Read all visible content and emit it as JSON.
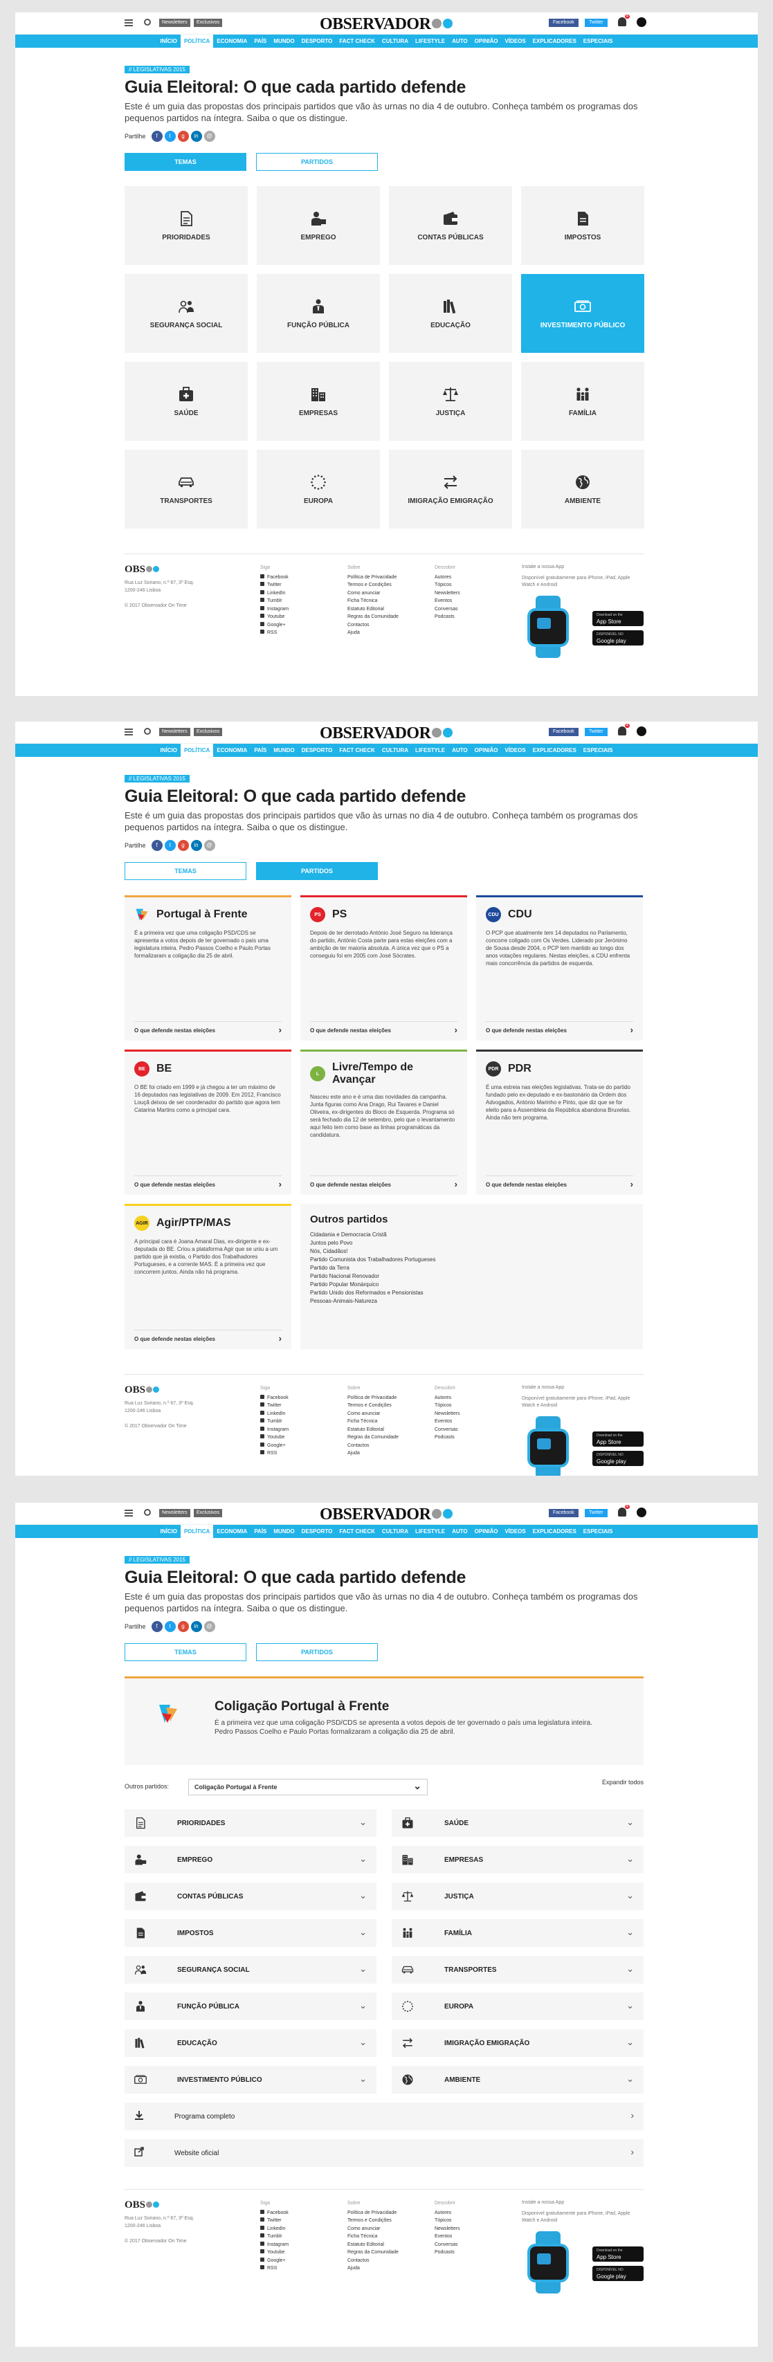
{
  "header": {
    "logo": "OBSERVADOR",
    "tag_newsletters": "Newsletters",
    "tag_exclusive": "Exclusivos",
    "facebook": "Facebook",
    "twitter": "Twitter",
    "notifications": "4"
  },
  "nav": [
    "INÍCIO",
    "POLÍTICA",
    "ECONOMIA",
    "PAÍS",
    "MUNDO",
    "DESPORTO",
    "FACT CHECK",
    "CULTURA",
    "LIFESTYLE",
    "AUTO",
    "OPINIÃO",
    "VÍDEOS",
    "EXPLICADORES",
    "ESPECIAIS"
  ],
  "nav_active": "POLÍTICA",
  "article": {
    "kicker": "// LEGISLATIVAS 2015",
    "title": "Guia Eleitoral: O que cada partido defende",
    "lead": "Este é um guia das propostas dos principais partidos que vão às urnas no dia 4 de outubro. Conheça também os programas dos pequenos partidos na íntegra. Saiba o que os distingue.",
    "share_label": "Partilhe",
    "tab_themes": "TEMAS",
    "tab_parties": "PARTIDOS"
  },
  "themes": [
    {
      "label": "PRIORIDADES",
      "icon": "document-icon"
    },
    {
      "label": "EMPREGO",
      "icon": "worker-icon"
    },
    {
      "label": "CONTAS PÚBLICAS",
      "icon": "wallet-icon"
    },
    {
      "label": "IMPOSTOS",
      "icon": "tax-document-icon"
    },
    {
      "label": "SEGURANÇA SOCIAL",
      "icon": "people-icon"
    },
    {
      "label": "FUNÇÃO PÚBLICA",
      "icon": "civil-servant-icon"
    },
    {
      "label": "EDUCAÇÃO",
      "icon": "books-icon"
    },
    {
      "label": "INVESTIMENTO PÚBLICO",
      "icon": "money-icon"
    },
    {
      "label": "SAÚDE",
      "icon": "medical-kit-icon"
    },
    {
      "label": "EMPRESAS",
      "icon": "buildings-icon"
    },
    {
      "label": "JUSTIÇA",
      "icon": "scales-icon"
    },
    {
      "label": "FAMÍLIA",
      "icon": "family-icon"
    },
    {
      "label": "TRANSPORTES",
      "icon": "car-icon"
    },
    {
      "label": "EUROPA",
      "icon": "eu-stars-icon"
    },
    {
      "label": "IMIGRAÇÃO EMIGRAÇÃO",
      "icon": "arrows-icon"
    },
    {
      "label": "AMBIENTE",
      "icon": "globe-icon"
    }
  ],
  "theme_active": "INVESTIMENTO PÚBLICO",
  "parties": [
    {
      "name": "Portugal à Frente",
      "color": "#f0a63f",
      "logo_text": "",
      "desc": "É a primeira vez que uma coligação PSD/CDS se apresenta a votos depois de ter governado o país uma legislatura inteira. Pedro Passos Coelho e Paulo Portas formalizaram a coligação dia 25 de abril.",
      "link": "O que defende nestas eleições"
    },
    {
      "name": "PS",
      "color": "#e3222b",
      "logo_text": "PS",
      "desc": "Depois de ter derrotado António José Seguro na liderança do partido, António Costa parte para estas eleições com a ambição de ter maioria absoluta. A única vez que o PS a conseguiu foi em 2005 com José Sócrates.",
      "link": "O que defende nestas eleições"
    },
    {
      "name": "CDU",
      "color": "#1e4a9a",
      "logo_text": "CDU",
      "desc": "O PCP que atualmente tem 14 deputados no Parlamento, concorre coligado com Os Verdes. Liderado por Jerónimo de Sousa desde 2004, o PCP tem mantido ao longo dos anos votações regulares. Nestas eleições, a CDU enfrenta mais concorrência da partidos de esquerda.",
      "link": "O que defende nestas eleições"
    },
    {
      "name": "BE",
      "color": "#e3222b",
      "logo_text": "BE",
      "desc": "O BE foi criado em 1999 e já chegou a ter um máximo de 16 deputados nas legislativas de 2009. Em 2012, Francisco Louçã deixou de ser coordenador do partido que agora tem Catarina Martins como a principal cara.",
      "link": "O que defende nestas eleições"
    },
    {
      "name": "Livre/Tempo de Avançar",
      "color": "#7cb342",
      "logo_text": "L",
      "desc": "Nasceu este ano e é uma das novidades da campanha. Junta figuras como Ana Drago, Rui Tavares e Daniel Oliveira, ex-dirigentes do Bloco de Esquerda. Programa só será fechado dia 12 de setembro, pelo que o levantamento aqui feito tem como base as linhas programáticas da candidatura.",
      "link": "O que defende nestas eleições"
    },
    {
      "name": "PDR",
      "color": "#333333",
      "logo_text": "PDR",
      "desc": "É uma estreia nas eleições legislativas. Trata-se do partido fundado pelo ex-deputado e ex-bastonário da Ordem dos Advogados, António Marinho e Pinto, que diz que se for eleito para a Assembleia da República abandona Bruxelas. Ainda não tem programa.",
      "link": "O que defende nestas eleições"
    },
    {
      "name": "Agir/PTP/MAS",
      "color": "#f5d01f",
      "logo_text": "AGIR",
      "desc": "A principal cara é Joana Amaral Dias, ex-dirigente e ex-deputada do BE. Criou a plataforma Agir que se uniu a um partido que já existia, o Partido dos Trabalhadores Portugueses, e a corrente MAS. É a primeira vez que concorrem juntos. Ainda não há programa.",
      "link": "O que defende nestas eleições"
    }
  ],
  "other_parties": {
    "title": "Outros partidos",
    "items": [
      "Cidadania e Democracia Cristã",
      "Juntos pelo Povo",
      "Nós, Cidadãos!",
      "Partido Comunista dos Trabalhadores Portugueses",
      "Partido da Terra",
      "Partido Nacional Renovador",
      "Partido Popular Monárquico",
      "Partido Unido dos Reformados e Pensionistas",
      "Pessoas-Animais-Natureza"
    ]
  },
  "party_detail": {
    "name": "Coligação Portugal à Frente",
    "desc": "É a primeira vez que uma coligação PSD/CDS se apresenta a votos depois de ter governado o país uma legislatura inteira. Pedro Passos Coelho e Paulo Portas formalizaram a coligação dia 25 de abril.",
    "select_label": "Outros partidos:",
    "select_value": "Coligação Portugal à Frente",
    "expand_all": "Expandir todos",
    "accordion_left": [
      {
        "label": "PRIORIDADES",
        "icon": "document-icon"
      },
      {
        "label": "EMPREGO",
        "icon": "worker-icon"
      },
      {
        "label": "CONTAS PÚBLICAS",
        "icon": "wallet-icon"
      },
      {
        "label": "IMPOSTOS",
        "icon": "tax-document-icon"
      },
      {
        "label": "SEGURANÇA SOCIAL",
        "icon": "people-icon"
      },
      {
        "label": "FUNÇÃO PÚBLICA",
        "icon": "civil-servant-icon"
      },
      {
        "label": "EDUCAÇÃO",
        "icon": "books-icon"
      },
      {
        "label": "INVESTIMENTO PÚBLICO",
        "icon": "money-icon"
      }
    ],
    "accordion_right": [
      {
        "label": "SAÚDE",
        "icon": "medical-kit-icon"
      },
      {
        "label": "EMPRESAS",
        "icon": "buildings-icon"
      },
      {
        "label": "JUSTIÇA",
        "icon": "scales-icon"
      },
      {
        "label": "FAMÍLIA",
        "icon": "family-icon"
      },
      {
        "label": "TRANSPORTES",
        "icon": "car-icon"
      },
      {
        "label": "EUROPA",
        "icon": "eu-stars-icon"
      },
      {
        "label": "IMIGRAÇÃO EMIGRAÇÃO",
        "icon": "arrows-icon"
      },
      {
        "label": "AMBIENTE",
        "icon": "globe-icon"
      }
    ],
    "full_program": "Programa completo",
    "website": "Website oficial"
  },
  "footer": {
    "logo": "OBS",
    "address": [
      "Rua Luz Soriano, n.º 67, 3º Esq.",
      "1200-246 Lisboa",
      "",
      "© 2017 Observador On Time"
    ],
    "col1_title": "Siga",
    "col1": [
      "Facebook",
      "Twitter",
      "LinkedIn",
      "Tumblr",
      "Instagram",
      "Youtube",
      "Google+",
      "RSS"
    ],
    "col2_title": "Sobre",
    "col2": [
      "Política de Privacidade",
      "Termos e Condições",
      "Como anunciar",
      "Ficha Técnica",
      "Estatuto Editorial",
      "Regras da Comunidade",
      "Contactos",
      "Ajuda"
    ],
    "col3_title": "Descobrir",
    "col3": [
      "Autores",
      "Tópicos",
      "Newsletters",
      "Eventos",
      "Conversas",
      "Podcasts"
    ],
    "app_title": "Instale a nossa App",
    "app_desc": "Disponível gratuitamente para iPhone, iPad, Apple Watch e Android",
    "app_store_small": "Download on the",
    "app_store": "App Store",
    "google_small": "DISPONÍVEL NO",
    "google_play": "Google play"
  }
}
